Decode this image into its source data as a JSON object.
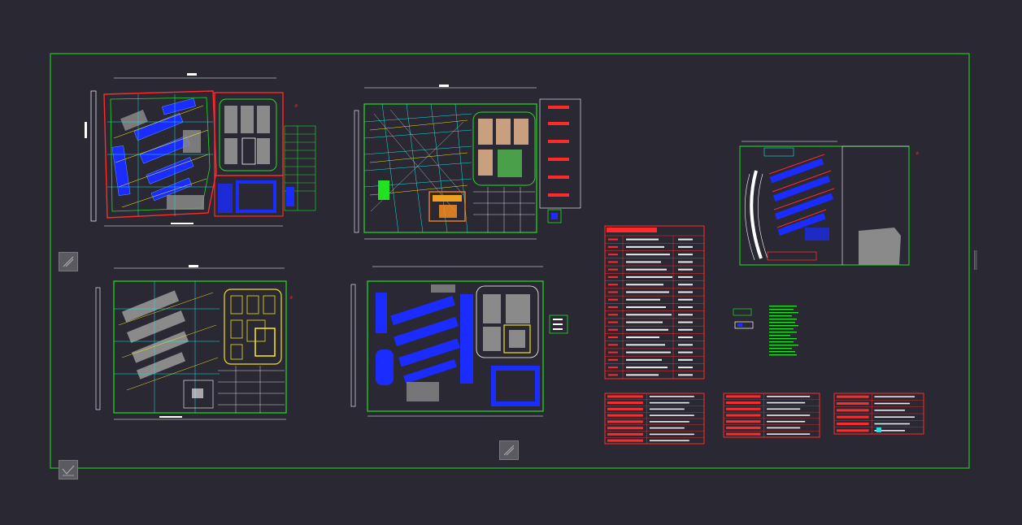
{
  "app": {
    "name": "",
    "background_color": "#2a2832"
  },
  "drawing": {
    "frame_color": "#1fc81f",
    "plans": [
      {
        "id": "plan-1",
        "north_label": "",
        "bottom_label": ""
      },
      {
        "id": "plan-2",
        "north_label": "",
        "bottom_label": ""
      },
      {
        "id": "plan-3",
        "north_label": "",
        "bottom_label": ""
      },
      {
        "id": "plan-4",
        "north_label": "",
        "bottom_label": ""
      },
      {
        "id": "plan-5",
        "north_label": "",
        "bottom_label": ""
      }
    ],
    "area_table": {
      "title": "",
      "rows": 19,
      "colors": {
        "header": "#ff2a2a",
        "line": "#ff3b3b",
        "text": "#ffffff"
      }
    },
    "legend_tables": [
      {
        "id": "legend-a",
        "rows": 8
      },
      {
        "id": "legend-b",
        "rows": 7
      },
      {
        "id": "legend-c",
        "rows": 6
      }
    ],
    "palette": {
      "red": "#ff2a2a",
      "green": "#22e022",
      "blue": "#1a2cff",
      "yellow": "#f0e020",
      "cyan": "#1fe0e0",
      "white": "#ffffff",
      "grey": "#8a8a8a",
      "magenta": "#d030d0"
    }
  },
  "ui": {
    "ucs_icon": "ucs-icon",
    "viewport_badges": [
      "viewport-badge-icon",
      "viewport-badge-icon",
      "viewport-badge-icon"
    ]
  }
}
